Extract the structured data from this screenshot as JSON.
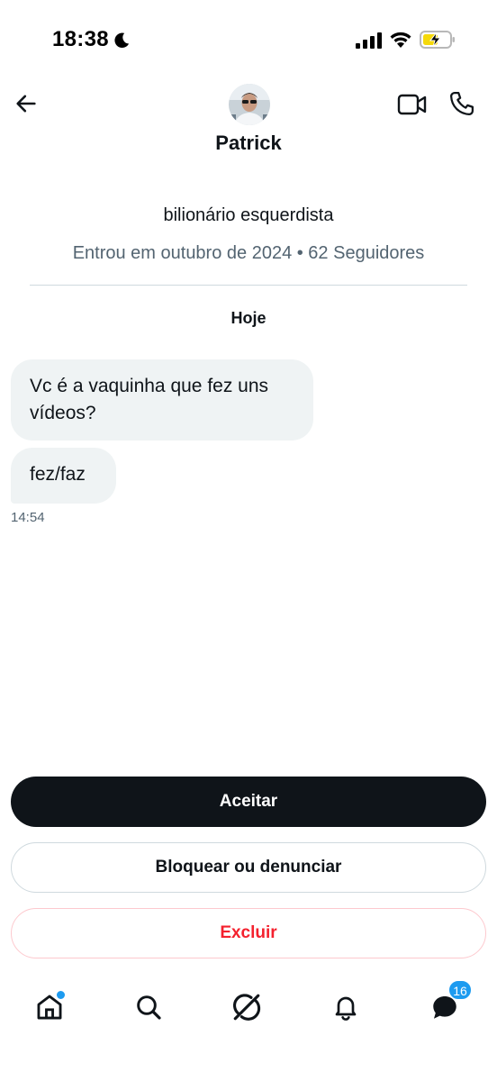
{
  "status_bar": {
    "time": "18:38",
    "icons": [
      "moon-icon",
      "cellular-signal-icon",
      "wifi-icon",
      "battery-charging-icon"
    ],
    "battery_color": "#f5d90a"
  },
  "header": {
    "contact_name": "Patrick",
    "icons": [
      "back-arrow-icon",
      "video-camera-icon",
      "phone-icon"
    ]
  },
  "profile": {
    "bio": "bilionário esquerdista",
    "meta": "Entrou em outubro de 2024 • 62 Seguidores"
  },
  "conversation": {
    "date_label": "Hoje",
    "messages": [
      {
        "text": "Vc é a vaquinha que fez uns vídeos?"
      },
      {
        "text": "fez/faz"
      }
    ],
    "last_time": "14:54"
  },
  "actions": {
    "accept_label": "Aceitar",
    "block_label": "Bloquear ou denunciar",
    "delete_label": "Excluir"
  },
  "bottom_nav": {
    "items": [
      "home-icon",
      "search-icon",
      "grok-icon",
      "notifications-bell-icon",
      "messages-icon"
    ],
    "messages_badge": "16"
  },
  "colors": {
    "accent": "#1d9bf0",
    "primary_text": "#0f1419",
    "secondary_text": "#536471",
    "danger": "#f4212e",
    "bubble_bg": "#eff3f4"
  }
}
